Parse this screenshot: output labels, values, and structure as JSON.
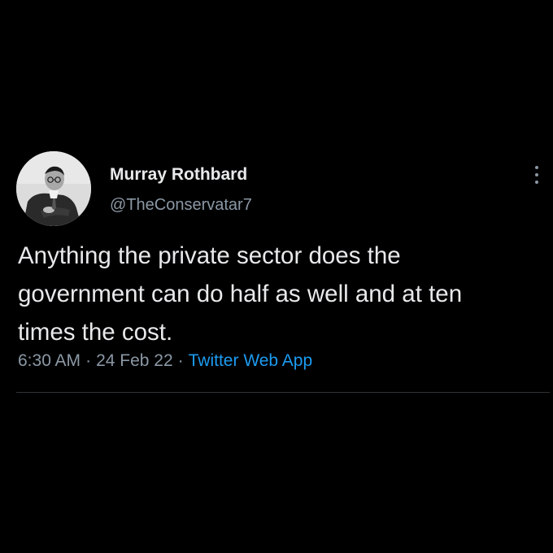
{
  "colors": {
    "background": "#000000",
    "primary_text": "#e7e9ea",
    "secondary_text": "#8b98a5",
    "link": "#1d9bf0",
    "divider": "#2f3336"
  },
  "author": {
    "display_name": "Murray Rothbard",
    "handle": "@TheConservatar7",
    "avatar_icon": "profile-photo"
  },
  "more_icon": "more-options-vertical-dots-icon",
  "tweet": {
    "text": "Anything the private sector does the\ngovernment can do half as well and at ten\ntimes the cost.",
    "time": "6:30 AM",
    "separator": "·",
    "date": "24 Feb 22",
    "source": "Twitter Web App"
  }
}
